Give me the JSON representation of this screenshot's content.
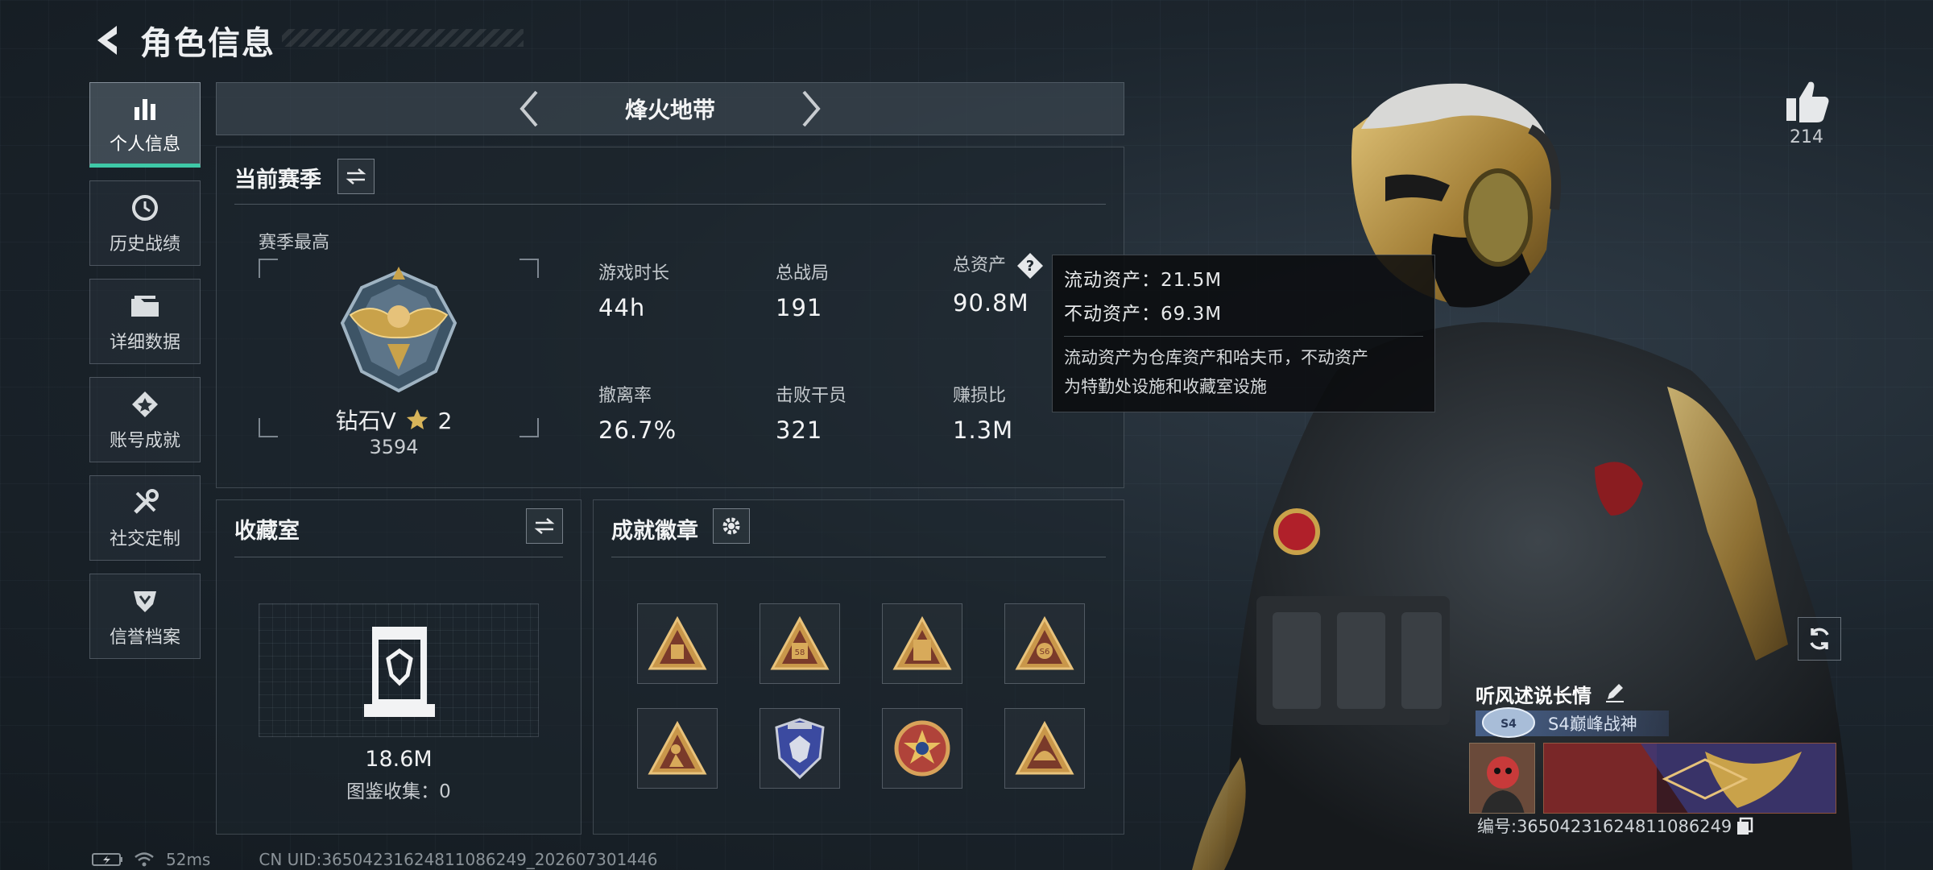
{
  "header": {
    "title": "角色信息"
  },
  "sidebar": {
    "items": [
      {
        "label": "个人信息",
        "icon": "bar-chart-icon",
        "active": true
      },
      {
        "label": "历史战绩",
        "icon": "history-clock-icon",
        "active": false
      },
      {
        "label": "详细数据",
        "icon": "folder-icon",
        "active": false
      },
      {
        "label": "账号成就",
        "icon": "achievement-icon",
        "active": false
      },
      {
        "label": "社交定制",
        "icon": "tools-icon",
        "active": false
      },
      {
        "label": "信誉档案",
        "icon": "reputation-icon",
        "active": false
      }
    ]
  },
  "map_selector": {
    "name": "烽火地带"
  },
  "season": {
    "title": "当前赛季",
    "best_label": "赛季最高",
    "rank_name": "钻石V",
    "rank_stars": "2",
    "rank_score": "3594",
    "stats": [
      {
        "label": "游戏时长",
        "value": "44h"
      },
      {
        "label": "总战局",
        "value": "191"
      },
      {
        "label": "总资产",
        "value": "90.8M"
      },
      {
        "label": "撤离率",
        "value": "26.7%"
      },
      {
        "label": "击败干员",
        "value": "321"
      },
      {
        "label": "赚损比",
        "value": "1.3M"
      }
    ]
  },
  "tooltip": {
    "liquid": "流动资产：21.5M",
    "fixed": "不动资产：69.3M",
    "desc_line1": "流动资产为仓库资产和哈夫币，不动资产",
    "desc_line2": "为特勤处设施和收藏室设施"
  },
  "collection": {
    "title": "收藏室",
    "value": "18.6M",
    "count": "图鉴收集：0"
  },
  "badges": {
    "title": "成就徽章",
    "items": [
      "badge-1",
      "badge-2",
      "badge-3",
      "badge-4",
      "badge-5",
      "badge-6",
      "badge-7",
      "badge-8"
    ]
  },
  "likes": {
    "count": "214"
  },
  "player": {
    "name": "听风述说长情",
    "title": "S4巅峰战神",
    "id": "编号:3650423162481108624​9"
  },
  "status": {
    "ping": "52ms",
    "uid": "CN UID:3650423162481108624​9_202607301446"
  },
  "colors": {
    "accent": "#3ec9a7",
    "gold": "#c9a24a",
    "panel_bg": "#1e262d"
  }
}
